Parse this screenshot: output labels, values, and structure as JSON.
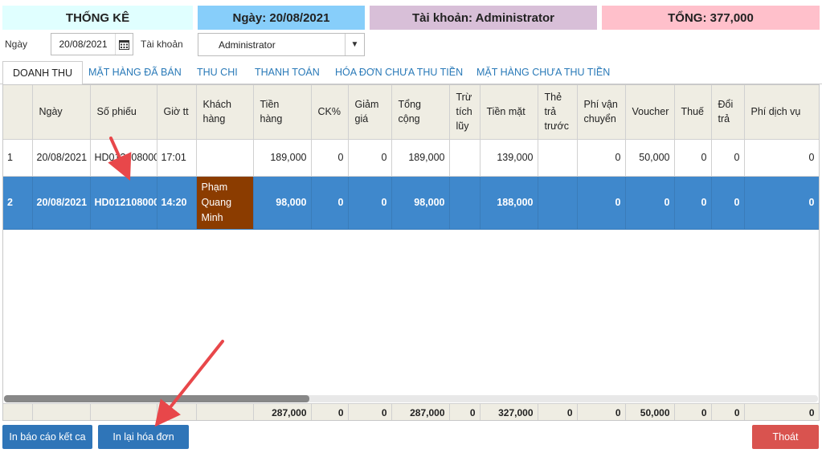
{
  "header": {
    "title": "THỐNG KÊ",
    "date": "Ngày: 20/08/2021",
    "account": "Tài khoản: Administrator",
    "total": "TỔNG: 377,000"
  },
  "filter": {
    "date_label": "Ngày",
    "date_value": "20/08/2021",
    "account_label": "Tài khoản",
    "account_value": "Administrator"
  },
  "tabs": [
    {
      "label": "DOANH THU",
      "active": true
    },
    {
      "label": "MẶT HÀNG ĐÃ BÁN",
      "active": false
    },
    {
      "label": "THU CHI",
      "active": false
    },
    {
      "label": "THANH TOÁN",
      "active": false
    },
    {
      "label": "HÓA ĐƠN CHƯA THU TIỀN",
      "active": false
    },
    {
      "label": "MẶT HÀNG CHƯA THU TIỀN",
      "active": false
    }
  ],
  "table": {
    "columns": [
      "",
      "Ngày",
      "Số phiếu",
      "Giờ tt",
      "Khách hàng",
      "Tiền hàng",
      "CK%",
      "Giảm giá",
      "Tổng cộng",
      "Trừ tích lũy",
      "Tiền mặt",
      "Thẻ trả trước",
      "Phí vận chuyển",
      "Voucher",
      "Thuế",
      "Đổi trả",
      "Phí dịch vụ"
    ],
    "rows": [
      {
        "stt": "1",
        "ngay": "20/08/2021",
        "so_phieu": "HD012108000",
        "gio": "17:01",
        "khach": "",
        "tien_hang": "189,000",
        "ck": "0",
        "giam_gia": "0",
        "tong_cong": "189,000",
        "tru_tich_luy": "",
        "tien_mat": "139,000",
        "the_tra_truoc": "",
        "phi_van_chuyen": "0",
        "voucher": "50,000",
        "thue": "0",
        "doi_tra": "0",
        "phi_dich_vu": "0"
      },
      {
        "stt": "2",
        "ngay": "20/08/2021",
        "so_phieu": "HD012108000",
        "gio": "14:20",
        "khach": "Phạm Quang Minh",
        "tien_hang": "98,000",
        "ck": "0",
        "giam_gia": "0",
        "tong_cong": "98,000",
        "tru_tich_luy": "",
        "tien_mat": "188,000",
        "the_tra_truoc": "",
        "phi_van_chuyen": "0",
        "voucher": "0",
        "thue": "0",
        "doi_tra": "0",
        "phi_dich_vu": "0"
      }
    ],
    "totals": {
      "tien_hang": "287,000",
      "ck": "0",
      "giam_gia": "0",
      "tong_cong": "287,000",
      "tru_tich_luy": "0",
      "tien_mat": "327,000",
      "the_tra_truoc": "0",
      "phi_van_chuyen": "0",
      "voucher": "50,000",
      "thue": "0",
      "doi_tra": "0",
      "phi_dich_vu": "0"
    }
  },
  "buttons": {
    "print_report": "In báo cáo kết ca",
    "reprint_invoice": "In lại hóa đơn",
    "exit": "Thoát"
  },
  "colors": {
    "accent_blue": "#2f75b8",
    "selected_row": "#3f88cc",
    "exit_red": "#d9534f",
    "annotation_arrow": "#e8474a"
  },
  "icons": {
    "calendar": "calendar-icon",
    "dropdown": "chevron-down-icon"
  }
}
